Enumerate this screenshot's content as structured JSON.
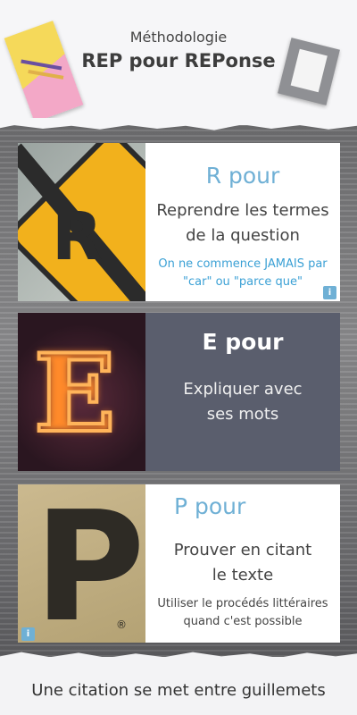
{
  "header": {
    "subtitle": "Méthodologie",
    "title": "REP pour REPonse"
  },
  "cards": [
    {
      "letter": "R",
      "heading": "R pour",
      "main": "Reprendre les termes de la question",
      "note": "On ne commence JAMAIS par \"car\" ou \"parce que\"",
      "info": "i",
      "style": "white"
    },
    {
      "letter": "E",
      "heading": "E pour",
      "main": "Expliquer avec ses mots",
      "style": "dark"
    },
    {
      "letter": "P",
      "heading": "P pour",
      "main": "Prouver en citant le texte",
      "note": "Utiliser le procédés littéraires quand c'est possible",
      "info": "i",
      "style": "white"
    }
  ],
  "footer": {
    "text": "Une citation se met entre guillemets"
  },
  "colors": {
    "accent": "#6fb0d5",
    "dark_card": "#5a5e6d",
    "note_blue": "#3aa0d5"
  },
  "icons": [
    "pencils-icon",
    "notepad-icon",
    "info-icon"
  ]
}
